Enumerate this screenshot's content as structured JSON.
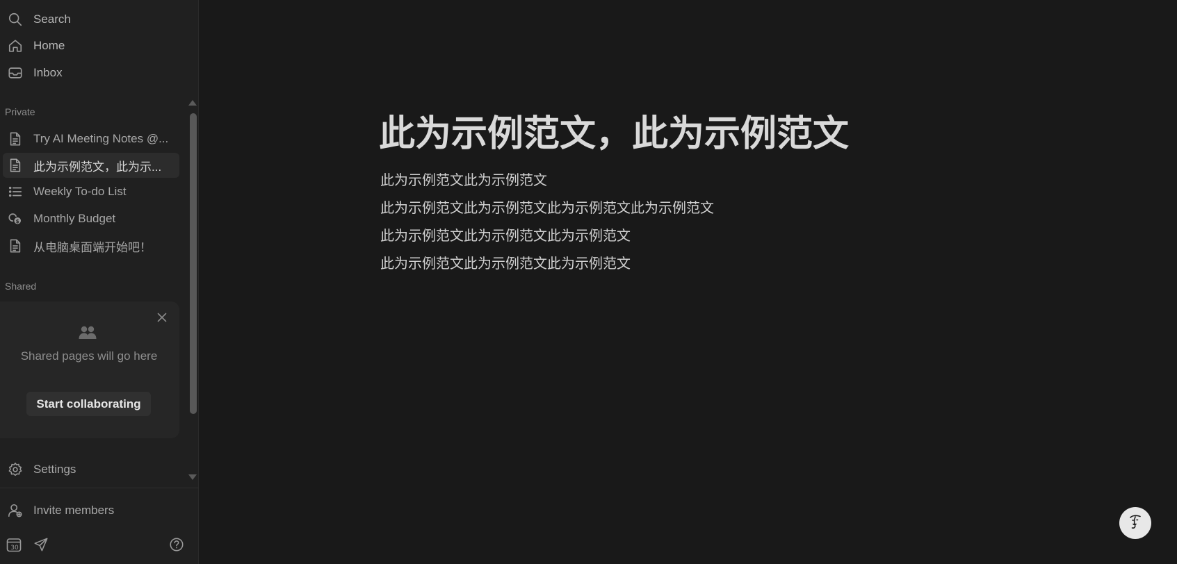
{
  "sidebar": {
    "top_items": [
      {
        "label": "Search",
        "icon": "search-icon"
      },
      {
        "label": "Home",
        "icon": "home-icon"
      },
      {
        "label": "Inbox",
        "icon": "inbox-icon"
      }
    ],
    "private_label": "Private",
    "private_items": [
      {
        "label": "Try AI Meeting Notes @...",
        "icon": "page-icon"
      },
      {
        "label": "此为示例范文，此为示...",
        "icon": "page-icon",
        "active": true
      },
      {
        "label": "Weekly To-do List",
        "icon": "list-icon"
      },
      {
        "label": "Monthly Budget",
        "icon": "budget-icon"
      },
      {
        "label": "从电脑桌面端开始吧！",
        "icon": "page-icon"
      }
    ],
    "shared_label": "Shared",
    "shared_card": {
      "message": "Shared pages will go here",
      "button_label": "Start collaborating"
    },
    "settings_label": "Settings",
    "invite_label": "Invite members",
    "calendar_day": "30"
  },
  "document": {
    "title": "此为示例范文，此为示例范文",
    "lines": [
      "此为示例范文此为示例范文",
      "此为示例范文此为示例范文此为示例范文此为示例范文",
      "此为示例范文此为示例范文此为示例范文",
      "此为示例范文此为示例范文此为示例范文"
    ]
  },
  "colors": {
    "background": "#191919",
    "sidebar": "#202020",
    "active_item": "#2c2c2c"
  }
}
